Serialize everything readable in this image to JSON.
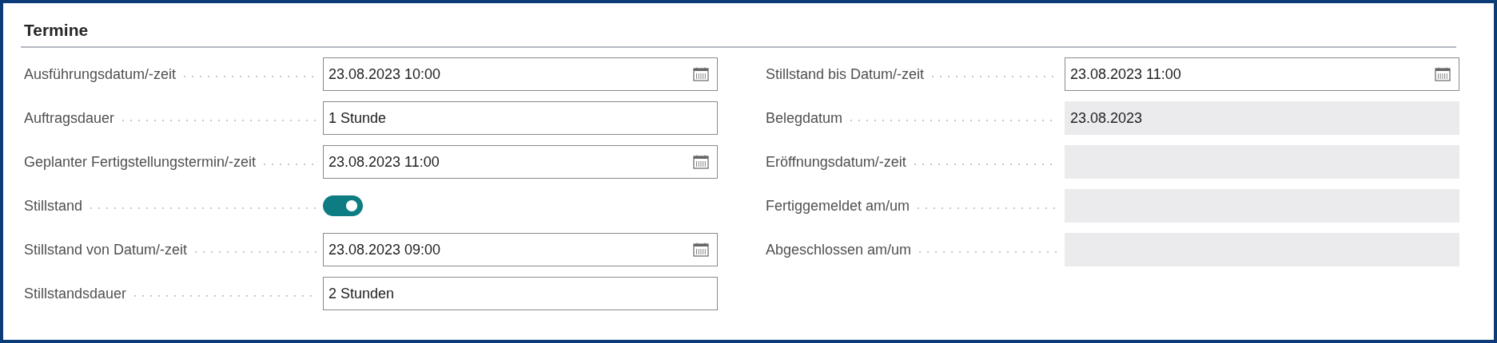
{
  "section": {
    "title": "Termine"
  },
  "columns": [
    [
      {
        "label": "Ausführungsdatum/-zeit",
        "kind": "date",
        "value": "23.08.2023 10:00"
      },
      {
        "label": "Auftragsdauer",
        "kind": "text",
        "value": "1 Stunde"
      },
      {
        "label": "Geplanter Fertigstellungstermin/-zeit",
        "kind": "date",
        "value": "23.08.2023 11:00"
      },
      {
        "label": "Stillstand",
        "kind": "toggle",
        "on": true
      },
      {
        "label": "Stillstand von Datum/-zeit",
        "kind": "date",
        "value": "23.08.2023 09:00"
      },
      {
        "label": "Stillstandsdauer",
        "kind": "text",
        "value": "2 Stunden"
      }
    ],
    [
      {
        "label": "Stillstand bis Datum/-zeit",
        "kind": "date",
        "value": "23.08.2023 11:00"
      },
      {
        "label": "Belegdatum",
        "kind": "readonly",
        "value": "23.08.2023"
      },
      {
        "label": "Eröffnungsdatum/-zeit",
        "kind": "readonly"
      },
      {
        "label": "Fertiggemeldet am/um",
        "kind": "readonly"
      },
      {
        "label": "Abgeschlossen am/um",
        "kind": "readonly"
      }
    ]
  ]
}
